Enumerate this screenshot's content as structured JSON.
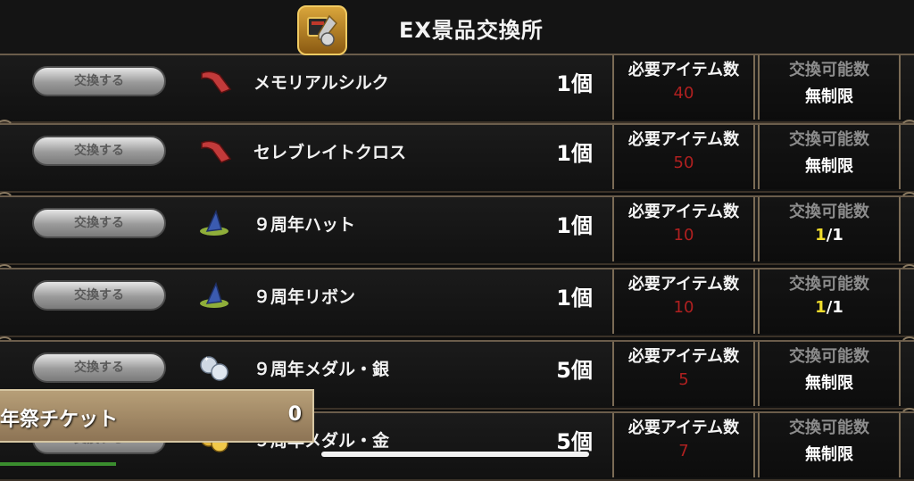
{
  "header": {
    "title": "EX景品交換所",
    "icon": "shop-icon"
  },
  "columns": {
    "required_label": "必要アイテム数",
    "available_label": "交換可能数"
  },
  "rows": [
    {
      "button": "交換する",
      "icon": "silk-cloth-icon",
      "name": "メモリアルシルク",
      "qty": "1個",
      "required": "40",
      "available": "無制限"
    },
    {
      "button": "交換する",
      "icon": "silk-cloth-icon",
      "name": "セレブレイトクロス",
      "qty": "1個",
      "required": "50",
      "available": "無制限"
    },
    {
      "button": "交換する",
      "icon": "wizard-hat-icon",
      "name": "９周年ハット",
      "qty": "1個",
      "required": "10",
      "available_cur": "1",
      "available_max": "/1"
    },
    {
      "button": "交換する",
      "icon": "wizard-hat-icon",
      "name": "９周年リボン",
      "qty": "1個",
      "required": "10",
      "available_cur": "1",
      "available_max": "/1"
    },
    {
      "button": "交換する",
      "icon": "silver-medal-icon",
      "name": "９周年メダル・銀",
      "qty": "5個",
      "required": "5",
      "available": "無制限"
    },
    {
      "button": "交換する",
      "icon": "gold-medal-icon",
      "name": "９周年メダル・金",
      "qty": "5個",
      "required": "7",
      "available": "無制限"
    }
  ],
  "ticket": {
    "name": "年祭チケット",
    "value": "0"
  },
  "colors": {
    "accent_required": "#b02020",
    "accent_count": "#f0dc2c",
    "border": "#7a6b55"
  }
}
